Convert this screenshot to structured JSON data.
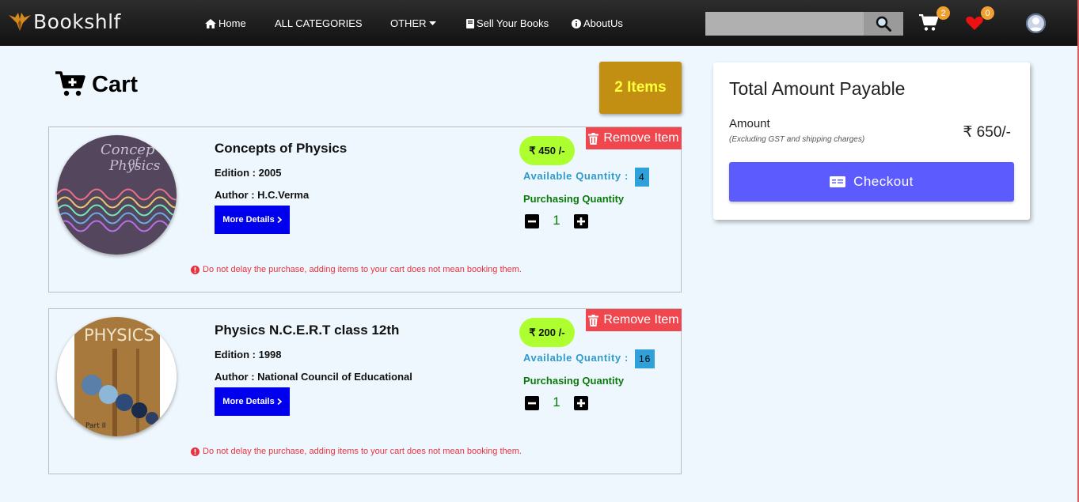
{
  "navbar": {
    "brand": "Bookshlf",
    "links": {
      "home": "Home",
      "categories": "ALL CATEGORIES",
      "other": "OTHER",
      "sell": "Sell Your Books",
      "about": "AboutUs"
    },
    "search": {
      "value": "",
      "placeholder": ""
    },
    "cart_count": "2",
    "wishlist_count": "0"
  },
  "cart": {
    "title": "Cart",
    "items_label": "2 Items",
    "items": [
      {
        "title": "Concepts of Physics",
        "edition": "Edition : 2005",
        "author": "Author : H.C.Verma",
        "more_label": "More Details",
        "remove_label": "Remove Item",
        "price": "₹ 450 /-",
        "available_label": "Available Quantity :",
        "available_qty": "4",
        "purchasing_label": "Purchasing Quantity",
        "purchasing_qty": "1",
        "warning": "Do not delay the purchase, adding items to your cart does not mean booking them."
      },
      {
        "title": "Physics N.C.E.R.T class 12th",
        "edition": "Edition : 1998",
        "author": "Author : National Council of Educational",
        "more_label": "More Details",
        "remove_label": "Remove Item",
        "price": "₹ 200 /-",
        "available_label": "Available Quantity :",
        "available_qty": "16",
        "purchasing_label": "Purchasing Quantity",
        "purchasing_qty": "1",
        "warning": "Do not delay the purchase, adding items to your cart does not mean booking them."
      }
    ]
  },
  "summary": {
    "title": "Total Amount Payable",
    "amount_label": "Amount",
    "amount_note": "(Excluding GST and shipping charges)",
    "amount_value": "₹ 650/-",
    "checkout_label": "Checkout"
  },
  "colors": {
    "accent": "#5b5bfe",
    "items_pill": "#c38f12",
    "items_text": "#ffff3c",
    "price_pill": "#adff2f",
    "remove": "#f0474f",
    "more_details": "#0000ee",
    "badge": "#f0a030",
    "available": "#2c9bcc",
    "purchasing": "#0a7a0a"
  },
  "icons": {
    "brand": "eagle-logo-icon",
    "home": "home-icon",
    "other": "caret-down-icon",
    "sell": "book-icon",
    "about": "info-circle-icon",
    "search": "search-icon",
    "cart": "cart-icon",
    "wishlist": "heart-icon",
    "user": "user-avatar-icon",
    "cart_title": "cart-plus-icon",
    "remove": "trash-icon",
    "more": "chevron-right-icon",
    "warning": "exclamation-circle-icon",
    "checkout": "money-check-icon"
  }
}
